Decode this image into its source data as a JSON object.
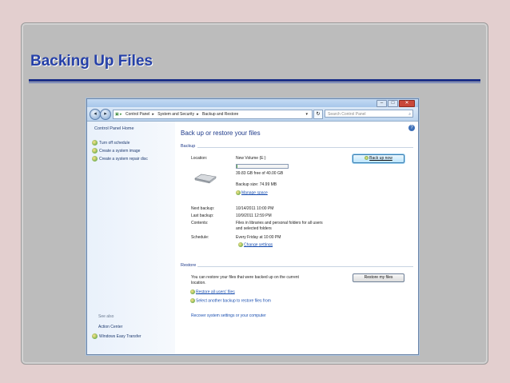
{
  "slide": {
    "title": "Backing Up Files"
  },
  "window": {
    "buttons": {
      "minimize": "–",
      "maximize": "□",
      "close": "✕"
    },
    "nav": {
      "back": "◂",
      "forward": "▸"
    },
    "breadcrumb": [
      "Control Panel",
      "System and Security",
      "Backup and Restore"
    ],
    "search_placeholder": "Search Control Panel",
    "refresh_label": "↻"
  },
  "sidebar": {
    "home": "Control Panel Home",
    "items": [
      {
        "label": "Turn off schedule",
        "icon": "shield-icon"
      },
      {
        "label": "Create a system image",
        "icon": "shield-icon"
      },
      {
        "label": "Create a system repair disc",
        "icon": "shield-icon"
      }
    ],
    "see_also_title": "See also",
    "see_also": [
      {
        "label": "Action Center",
        "icon": ""
      },
      {
        "label": "Windows Easy Transfer",
        "icon": "shield-icon"
      }
    ]
  },
  "main": {
    "title": "Back up or restore your files",
    "backup_section": "Backup",
    "location_label": "Location:",
    "location_value": "New Volume (E:)",
    "free_space": "39.83 GB free of 40.00 GB",
    "progress_fraction": 0.004,
    "backup_size": "Backup size: 74.99 MB",
    "manage_space": "Manage space",
    "next_backup_label": "Next backup:",
    "next_backup_value": "10/14/2011 10:00 PM",
    "last_backup_label": "Last backup:",
    "last_backup_value": "10/9/2011 12:59 PM",
    "contents_label": "Contents:",
    "contents_value_1": "Files in libraries and personal folders for all users",
    "contents_value_2": "and selected folders",
    "schedule_label": "Schedule:",
    "schedule_value": "Every Friday at 10:00 PM",
    "change_settings": "Change settings",
    "back_up_now": "Back up now",
    "restore_section": "Restore",
    "restore_text_1": "You can restore your files that were backed up on the current",
    "restore_text_2": "location.",
    "restore_my_files": "Restore my files",
    "restore_all_users": "Restore all users' files",
    "select_another_backup": "Select another backup to restore files from",
    "recover_settings": "Recover system settings or your computer"
  },
  "colors": {
    "title_blue": "#2540a8",
    "link_blue": "#1a4fb0",
    "heading_blue": "#1e3a8a"
  }
}
